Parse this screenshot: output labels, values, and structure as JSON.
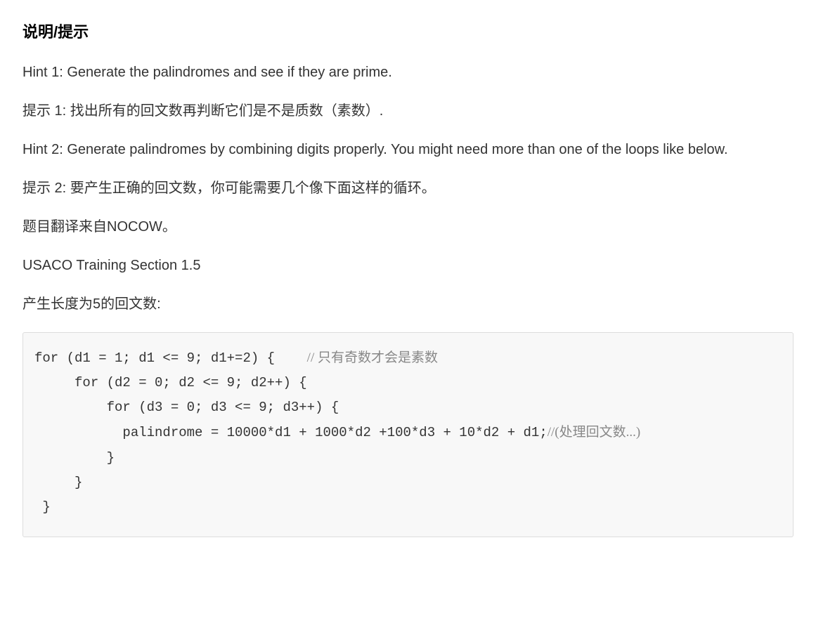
{
  "heading": "说明/提示",
  "paragraphs": [
    "Hint 1: Generate the palindromes and see if they are prime.",
    "提示 1: 找出所有的回文数再判断它们是不是质数（素数）.",
    "Hint 2: Generate palindromes by combining digits properly. You might need more than one of the loops like below.",
    "提示 2: 要产生正确的回文数，你可能需要几个像下面这样的循环。",
    "题目翻译来自NOCOW。",
    "USACO Training Section 1.5",
    "产生长度为5的回文数:"
  ],
  "code": {
    "line1_a": "for (d1 = 1; d1 <= 9; d1+=2) {    ",
    "line1_comment": "// 只有奇数才会是素数",
    "line2": "     for (d2 = 0; d2 <= 9; d2++) {",
    "line3": "         for (d3 = 0; d3 <= 9; d3++) {",
    "line4_a": "           palindrome = 10000*d1 + 1000*d2 +100*d3 + 10*d2 + d1;",
    "line4_comment": "//(处理回文数...)",
    "line5": "         }",
    "line6": "     }",
    "line7": " }"
  }
}
